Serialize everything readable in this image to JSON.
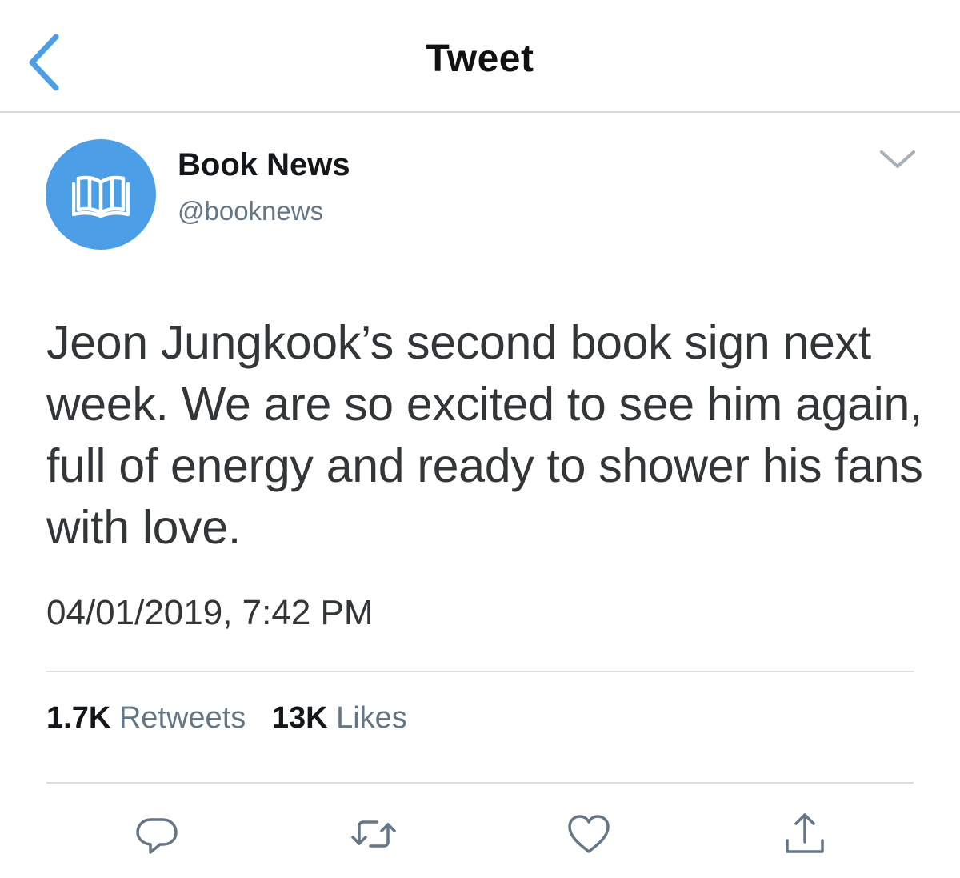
{
  "header": {
    "title": "Tweet",
    "back_icon": "chevron-left-icon"
  },
  "author": {
    "display_name": "Book News",
    "handle": "@booknews",
    "avatar_icon": "open-book-icon",
    "avatar_color": "#4c9fe6"
  },
  "tweet": {
    "text": "Jeon Jungkook’s second book sign next week. We are so excited to see him again, full of energy and ready to shower his fans with love.",
    "timestamp": "04/01/2019, 7:42 PM"
  },
  "stats": {
    "retweets_count": "1.7K",
    "retweets_label": "Retweets",
    "likes_count": "13K",
    "likes_label": "Likes"
  },
  "actions": [
    {
      "name": "reply",
      "icon": "reply-icon"
    },
    {
      "name": "retweet",
      "icon": "retweet-icon"
    },
    {
      "name": "like",
      "icon": "heart-icon"
    },
    {
      "name": "share",
      "icon": "share-icon"
    }
  ],
  "colors": {
    "accent": "#4c9fe6",
    "icon_gray": "#657786",
    "divider": "#dcdcdc"
  }
}
